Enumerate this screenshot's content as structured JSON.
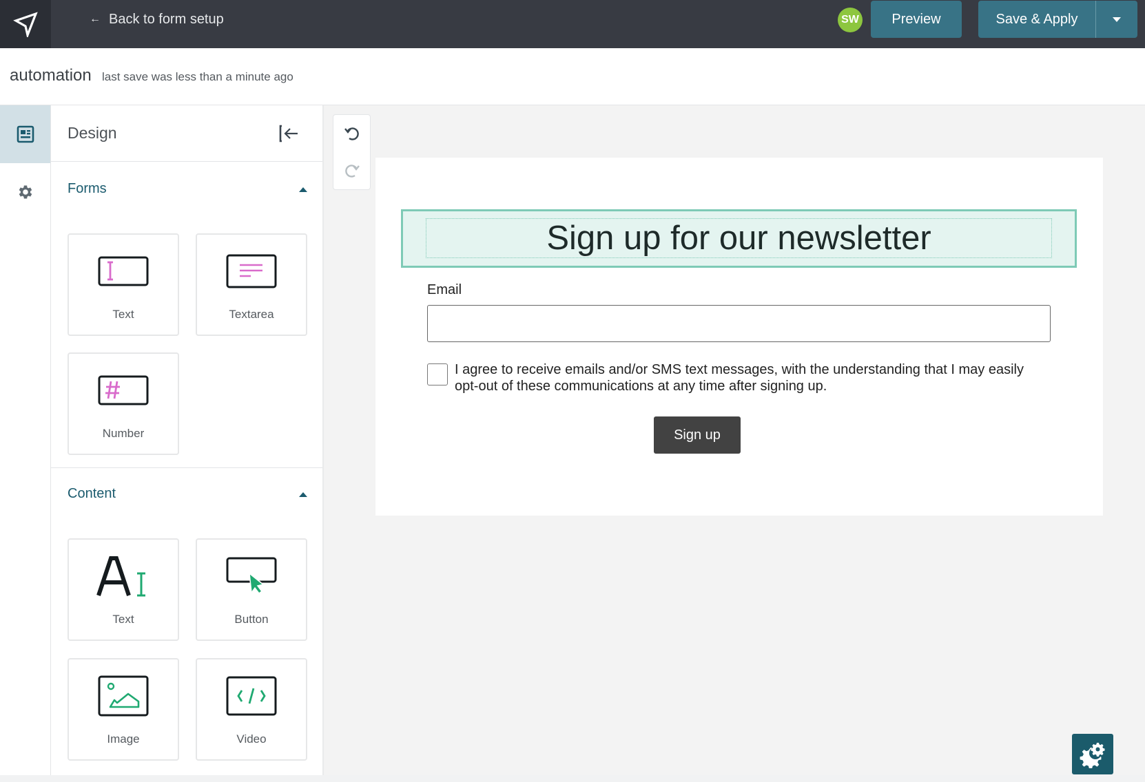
{
  "header": {
    "logo_icon": "paper-plane-icon",
    "back_arrow": "←",
    "back_label": "Back to form setup",
    "avatar_initials": "SW",
    "preview_label": "Preview",
    "save_apply_label": "Save & Apply"
  },
  "subheader": {
    "form_name": "automation",
    "save_status": "last save was less than a minute ago"
  },
  "rail": {
    "items": [
      {
        "name": "design",
        "icon": "layout-icon",
        "active": true
      },
      {
        "name": "settings",
        "icon": "gear-icon",
        "active": false
      }
    ]
  },
  "panel": {
    "title": "Design",
    "sections": [
      {
        "label": "Forms",
        "expanded": true,
        "tiles": [
          {
            "label": "Text",
            "icon": "text-input-icon"
          },
          {
            "label": "Textarea",
            "icon": "textarea-icon"
          },
          {
            "label": "Number",
            "icon": "number-input-icon"
          }
        ]
      },
      {
        "label": "Content",
        "expanded": true,
        "tiles": [
          {
            "label": "Text",
            "icon": "text-content-icon"
          },
          {
            "label": "Button",
            "icon": "button-icon"
          },
          {
            "label": "Image",
            "icon": "image-icon"
          },
          {
            "label": "Video",
            "icon": "video-embed-icon"
          }
        ]
      }
    ]
  },
  "canvas": {
    "headline": "Sign up for our newsletter",
    "email_label": "Email",
    "email_value": "",
    "consent_checked": false,
    "consent_text": "I agree to receive emails and/or SMS text messages, with the understanding that I may easily opt-out of these communications at any time after signing up.",
    "submit_label": "Sign up"
  },
  "colors": {
    "header_bg": "#383b43",
    "brand_button": "#387386",
    "avatar": "#8dc63f",
    "section_label": "#1b5b6e",
    "selection_outline": "#7ecab6",
    "form_icon_accent": "#d96bcb",
    "content_icon_accent": "#1fa971",
    "submit_button": "#424242"
  }
}
